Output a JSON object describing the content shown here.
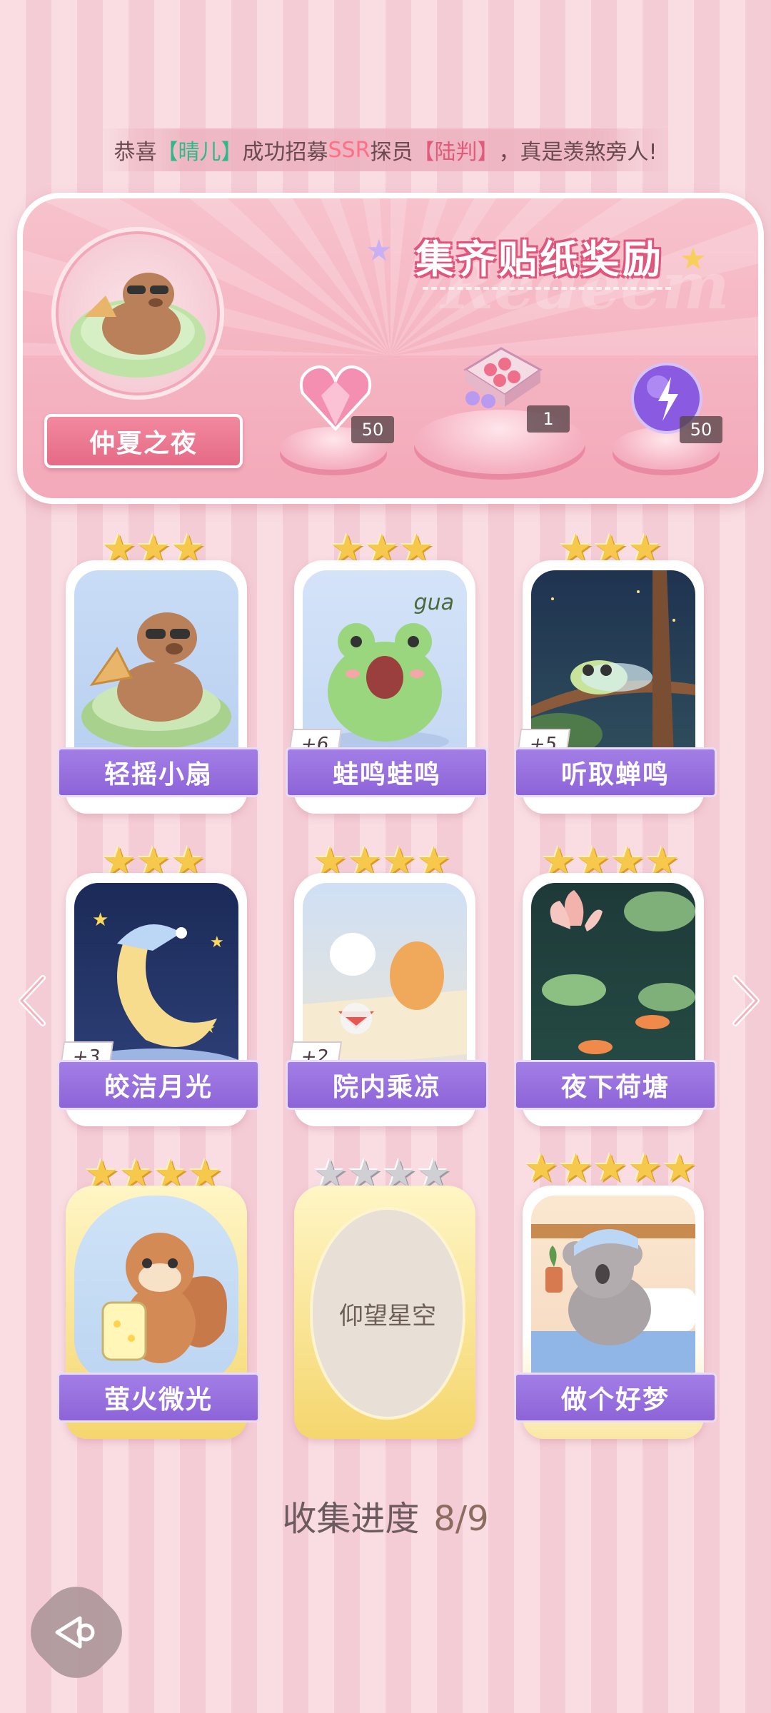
{
  "ticker": {
    "prefix": "恭喜",
    "player": "【晴儿】",
    "mid1": "成功招募",
    "rarity": "SSR",
    "mid2": "探员",
    "character": "【陆判】",
    "suffix": "，真是羡煞旁人!"
  },
  "reward_panel": {
    "title": "集齐贴纸奖励",
    "watermark": "Redeem",
    "theme_name": "仲夏之夜",
    "rewards": [
      {
        "icon": "pink-heart-gem-icon",
        "count": "50"
      },
      {
        "icon": "gift-box-icon",
        "count": "1"
      },
      {
        "icon": "purple-energy-orb-icon",
        "count": "50"
      }
    ]
  },
  "stickers": [
    {
      "name": "轻摇小扇",
      "stars": 3,
      "plus": null,
      "style": "white",
      "art": "capybara-fan-art"
    },
    {
      "name": "蛙鸣蛙鸣",
      "stars": 3,
      "plus": "+6",
      "style": "white",
      "art": "frog-gua-art",
      "art_text": "gua"
    },
    {
      "name": "听取蝉鸣",
      "stars": 3,
      "plus": "+5",
      "style": "white",
      "art": "cicada-branch-art"
    },
    {
      "name": "皎洁月光",
      "stars": 3,
      "plus": "+3",
      "style": "white",
      "art": "sleepy-moon-art"
    },
    {
      "name": "院内乘凉",
      "stars": 4,
      "plus": "+2",
      "style": "white",
      "art": "cats-watermelon-picnic-art"
    },
    {
      "name": "夜下荷塘",
      "stars": 4,
      "plus": null,
      "style": "white",
      "art": "lotus-pond-koi-art"
    },
    {
      "name": "萤火微光",
      "stars": 4,
      "plus": null,
      "style": "gold",
      "art": "squirrel-firefly-jar-art"
    },
    {
      "name": "仰望星空",
      "stars": 4,
      "plus": null,
      "style": "locked",
      "art": "locked-placeholder",
      "stars_grey": true
    },
    {
      "name": "做个好梦",
      "stars": 5,
      "plus": null,
      "style": "gold-white",
      "art": "koala-sleeping-art"
    }
  ],
  "progress": {
    "label": "收集进度",
    "value": "8/9"
  },
  "colors": {
    "accent_purple": "#8d64d8",
    "panel_pink": "#f3a9b9",
    "star_gold": "#f6c84b"
  }
}
